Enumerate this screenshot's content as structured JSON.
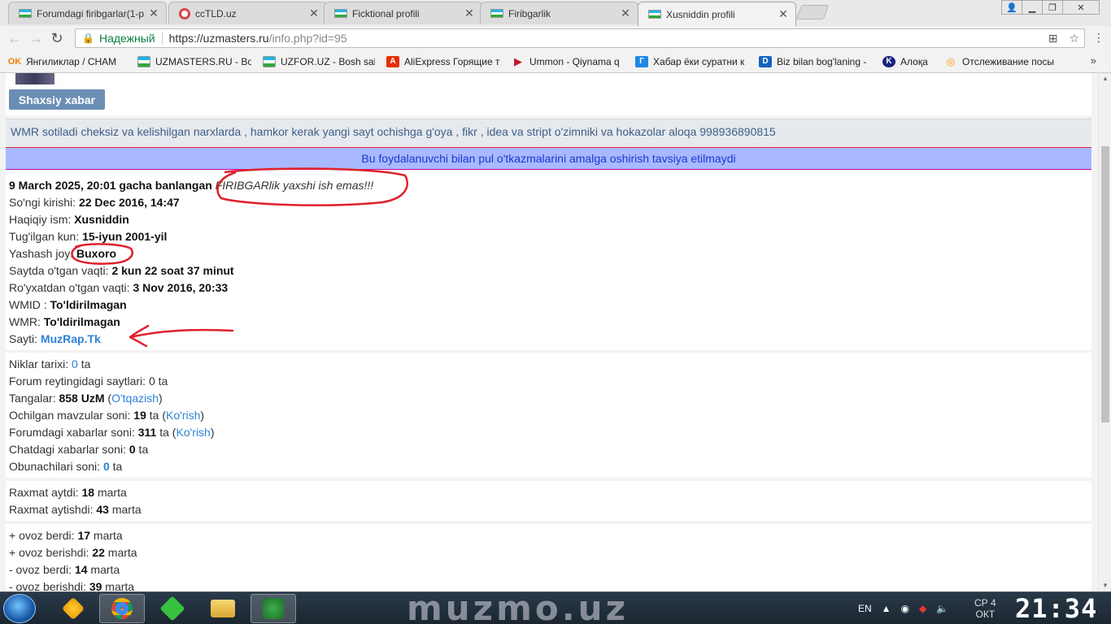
{
  "browser": {
    "tabs": [
      {
        "title": "Forumdagi firibgarlar(1-p",
        "icon": "uz-flag"
      },
      {
        "title": "ccTLD.uz",
        "icon": "cctld-icon"
      },
      {
        "title": "Ficktional profili",
        "icon": "uz-flag"
      },
      {
        "title": "Firibgarlik",
        "icon": "uz-flag"
      },
      {
        "title": "Xusniddin profili",
        "icon": "uz-flag",
        "active": true
      }
    ],
    "omnibox": {
      "secure_label": "Надежный",
      "url_base": "https://uzmasters.ru",
      "url_path": "/info.php?id=95"
    },
    "bookmarks": [
      {
        "label": "Янгиликлар / CHAM",
        "icon": "OK",
        "color": "#f57c00"
      },
      {
        "label": "UZMASTERS.RU - Bo",
        "icon": "uz-flag",
        "color": ""
      },
      {
        "label": "UZFOR.UZ - Bosh sah",
        "icon": "uz-flag",
        "color": ""
      },
      {
        "label": "AliExpress Горящие т",
        "icon": "A",
        "color": "#e62e04"
      },
      {
        "label": "Ummon - Qiynama q",
        "icon": "▶",
        "color": "#c0182a"
      },
      {
        "label": "Хабар ёки суратни к",
        "icon": "Г",
        "color": "#1e88e5"
      },
      {
        "label": "Biz bilan bog'laning -",
        "icon": "D",
        "color": "#1565c0"
      },
      {
        "label": "Алоқа",
        "icon": "K",
        "color": "#1a237e"
      },
      {
        "label": "Отслеживание посы",
        "icon": "Q",
        "color": "#ff9800"
      }
    ],
    "bookmarks_more": "»"
  },
  "page": {
    "pm_button": "Shaxsiy xabar",
    "status_text": "WMR sotiladi cheksiz va kelishilgan narxlarda , hamkor kerak yangi sayt ochishga g'oya , fikr , idea va stript o'zimniki va hokazolar aloqa 998936890815",
    "warning": "Bu foydalanuvchi bilan pul o'tkazmalarini amalga oshirish tavsiya etilmaydi",
    "profile": {
      "ban_text": "9 March 2025, 20:01 gacha banlangan",
      "ban_reason": "FIRIBGARlik yaxshi ish emas!!!",
      "last_login_label": "So'ngi kirishi: ",
      "last_login": "22 Dec 2016, 14:47",
      "real_name_label": "Haqiqiy ism: ",
      "real_name": "Xusniddin",
      "birthday_label": "Tug'ilgan kun: ",
      "birthday": "15-iyun 2001-yil",
      "location_label": "Yashash joy: ",
      "location": "Buxoro",
      "time_on_site_label": "Saytda o'tgan vaqti: ",
      "time_on_site": "2 kun 22 soat 37 minut",
      "registered_label": "Ro'yxatdan o'tgan vaqti: ",
      "registered": "3 Nov 2016, 20:33",
      "wmid_label": "WMID : ",
      "wmid": "To'ldirilmagan",
      "wmr_label": "WMR: ",
      "wmr": "To'ldirilmagan",
      "site_label": "Sayti: ",
      "site": "MuzRap.Tk"
    },
    "stats": {
      "nick_history_label": "Niklar tarixi: ",
      "nick_history": "0",
      "nick_history_suffix": " ta",
      "rated_sites_label": "Forum reytingidagi saytlari: ",
      "rated_sites": "0 ta",
      "coins_label": "Tangalar: ",
      "coins": "858 UzM",
      "transfer_link": "O'tqazish",
      "topics_label": "Ochilgan mavzular soni: ",
      "topics": "19",
      "topics_suffix": " ta",
      "view_link": "Ko'rish",
      "posts_label": "Forumdagi xabarlar soni: ",
      "posts": "311",
      "posts_suffix": " ta",
      "chat_label": "Chatdagi xabarlar soni: ",
      "chat": "0",
      "chat_suffix": " ta",
      "subscribers_label": "Obunachilari soni: ",
      "subscribers": "0",
      "subscribers_suffix": " ta"
    },
    "thanks": {
      "gave_label": "Raxmat aytdi: ",
      "gave": "18",
      "got_label": "Raxmat aytishdi: ",
      "got": "43",
      "unit": " marta"
    },
    "votes": {
      "plus_gave_label": "+ ovoz berdi: ",
      "plus_gave": "17",
      "plus_got_label": "+ ovoz berishdi: ",
      "plus_got": "22",
      "minus_gave_label": "- ovoz berdi: ",
      "minus_gave": "14",
      "minus_got_label": "- ovoz berishdi: ",
      "minus_got": "39",
      "unit": " marta"
    }
  },
  "taskbar": {
    "wallpaper_text": "muzmo.uz",
    "language": "EN",
    "date_day": "СР 4",
    "date_month": "ОКТ",
    "time": "21:34"
  },
  "colors": {
    "annotation": "#e0202c",
    "link": "#2c82d8",
    "warning_bg": "#a8b9ff"
  }
}
